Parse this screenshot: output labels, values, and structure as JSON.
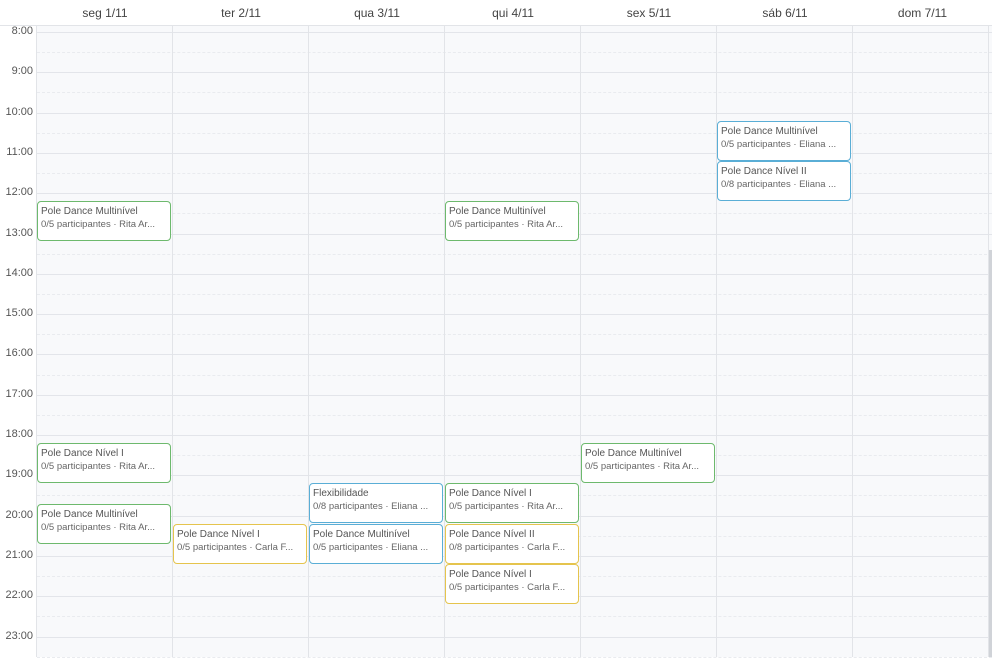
{
  "days": [
    {
      "label": "seg 1/11"
    },
    {
      "label": "ter 2/11"
    },
    {
      "label": "qua 3/11"
    },
    {
      "label": "qui 4/11"
    },
    {
      "label": "sex 5/11"
    },
    {
      "label": "sáb 6/11"
    },
    {
      "label": "dom 7/11"
    }
  ],
  "hours": [
    "8:00",
    "9:00",
    "10:00",
    "11:00",
    "12:00",
    "13:00",
    "14:00",
    "15:00",
    "16:00",
    "17:00",
    "18:00",
    "19:00",
    "20:00",
    "21:00",
    "22:00",
    "23:00"
  ],
  "colors": {
    "green": "#6db96d",
    "blue": "#5aaed6",
    "yellow": "#e5c44d"
  },
  "events": [
    {
      "day": 0,
      "start": 12.2,
      "dur": 1,
      "color": "green",
      "title": "Pole Dance Multinível",
      "sub": "0/5 participantes · Rita Ar..."
    },
    {
      "day": 0,
      "start": 18.2,
      "dur": 1,
      "color": "green",
      "title": "Pole Dance Nível I",
      "sub": "0/5 participantes · Rita Ar..."
    },
    {
      "day": 0,
      "start": 19.7,
      "dur": 1,
      "color": "green",
      "title": "Pole Dance Multinível",
      "sub": "0/5 participantes · Rita Ar..."
    },
    {
      "day": 1,
      "start": 20.2,
      "dur": 1,
      "color": "yellow",
      "title": "Pole Dance Nível I",
      "sub": "0/5 participantes · Carla F..."
    },
    {
      "day": 2,
      "start": 19.2,
      "dur": 1,
      "color": "blue",
      "title": "Flexibilidade",
      "sub": "0/8 participantes · Eliana ..."
    },
    {
      "day": 2,
      "start": 20.2,
      "dur": 1,
      "color": "blue",
      "title": "Pole Dance Multinível",
      "sub": "0/5 participantes · Eliana ..."
    },
    {
      "day": 3,
      "start": 12.2,
      "dur": 1,
      "color": "green",
      "title": "Pole Dance Multinível",
      "sub": "0/5 participantes · Rita Ar..."
    },
    {
      "day": 3,
      "start": 19.2,
      "dur": 1,
      "color": "green",
      "title": "Pole Dance Nível I",
      "sub": "0/5 participantes · Rita Ar..."
    },
    {
      "day": 3,
      "start": 20.2,
      "dur": 1,
      "color": "yellow",
      "title": "Pole Dance Nível II",
      "sub": "0/8 participantes · Carla F..."
    },
    {
      "day": 3,
      "start": 21.2,
      "dur": 1,
      "color": "yellow",
      "title": "Pole Dance Nível I",
      "sub": "0/5 participantes · Carla F..."
    },
    {
      "day": 4,
      "start": 18.2,
      "dur": 1,
      "color": "green",
      "title": "Pole Dance Multinível",
      "sub": "0/5 participantes · Rita Ar..."
    },
    {
      "day": 5,
      "start": 10.2,
      "dur": 1,
      "color": "blue",
      "title": "Pole Dance Multinível",
      "sub": "0/5 participantes · Eliana ..."
    },
    {
      "day": 5,
      "start": 11.2,
      "dur": 1,
      "color": "blue",
      "title": "Pole Dance Nível II",
      "sub": "0/8 participantes · Eliana ..."
    }
  ]
}
